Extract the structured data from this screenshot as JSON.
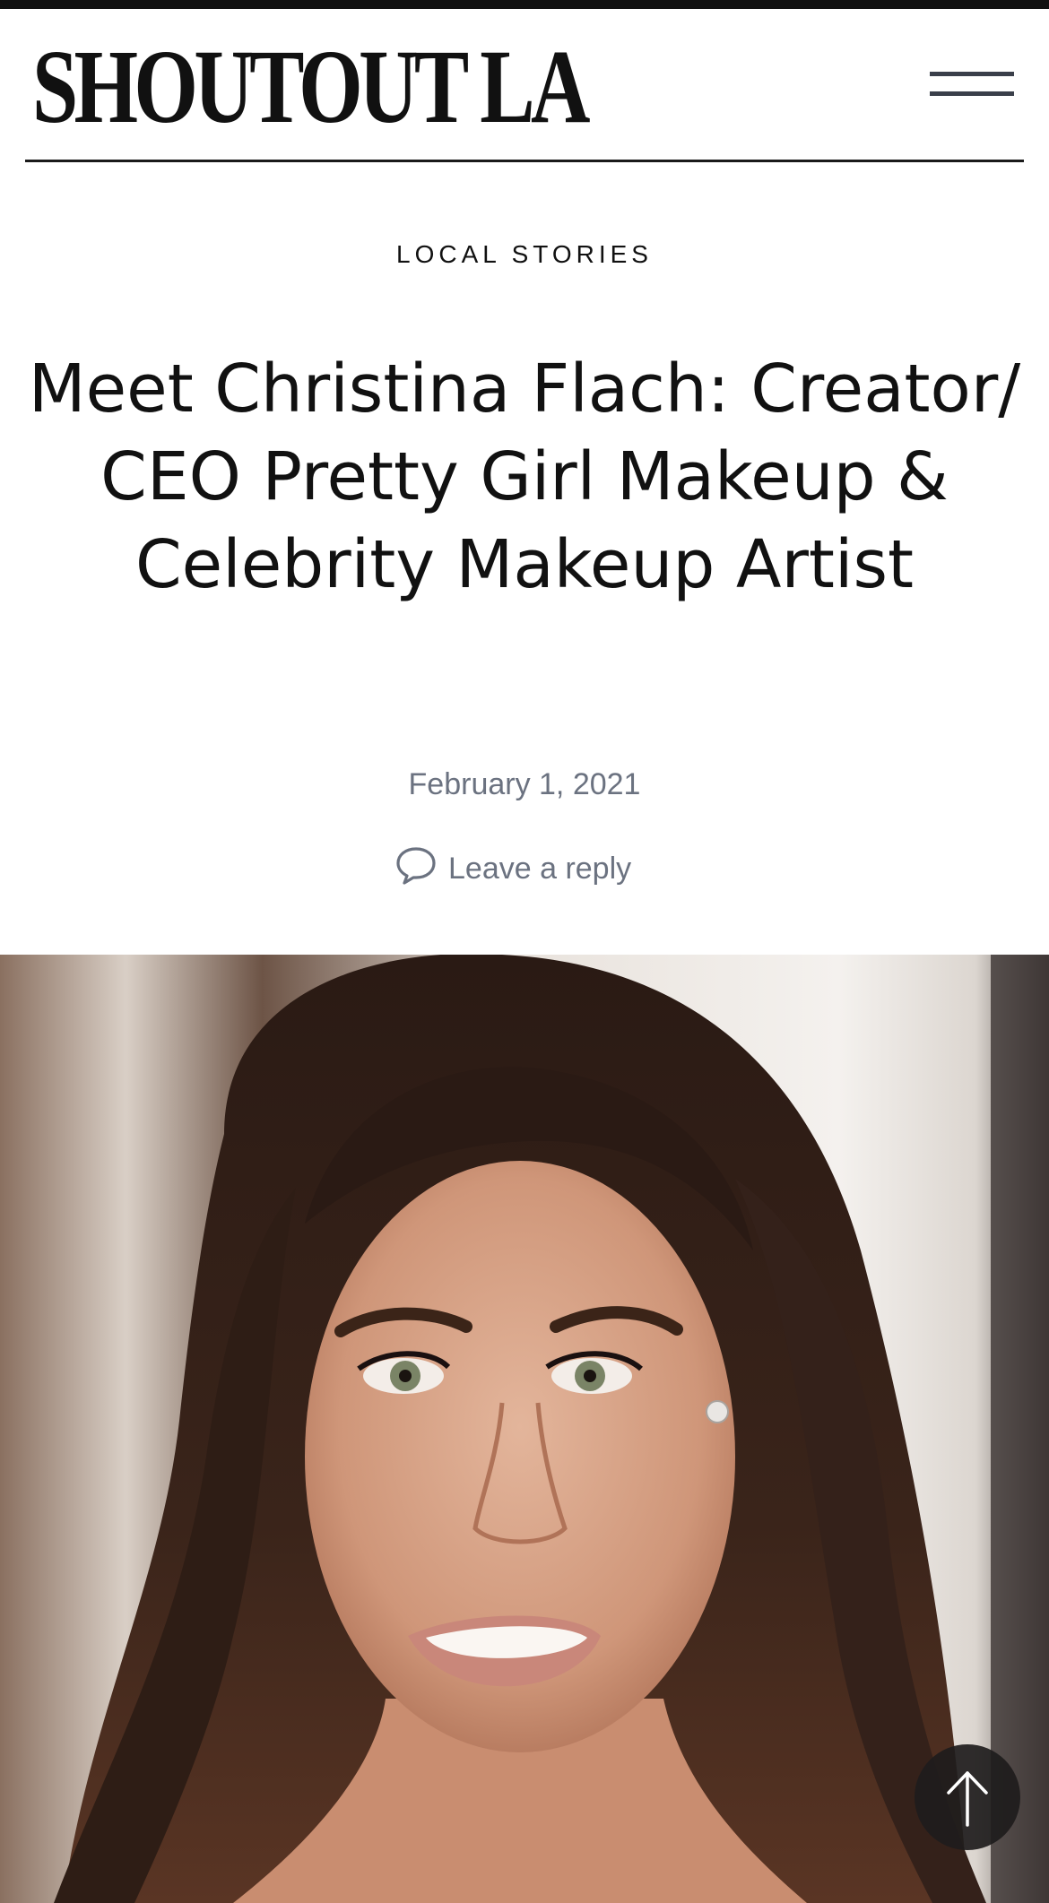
{
  "site": {
    "title": "SHOUTOUT LA"
  },
  "article": {
    "category": "LOCAL STORIES",
    "title": "Meet Christina Flach: Creator/ CEO Pretty Girl Makeup & Celebrity Makeup Artist",
    "date": "February 1, 2021",
    "reply_label": "Leave a reply"
  },
  "icons": {
    "menu": "hamburger-menu-icon",
    "comment": "speech-bubble-icon",
    "scroll_top": "arrow-up-icon"
  },
  "colors": {
    "text": "#111111",
    "meta": "#6b7280",
    "accent_dark": "#1e1c1c"
  }
}
